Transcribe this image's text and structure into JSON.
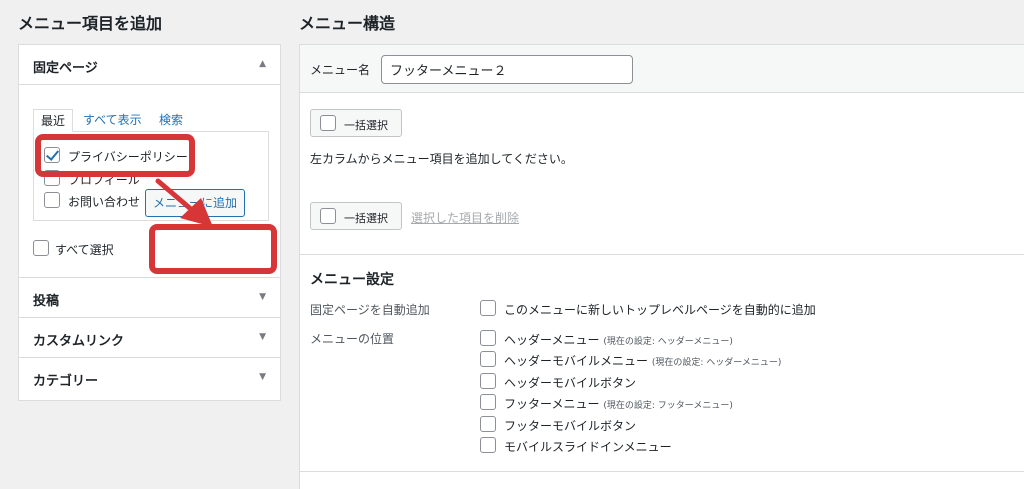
{
  "left": {
    "title": "メニュー項目を追加",
    "section_title": "固定ページ",
    "tabs": [
      "最近",
      "すべて表示",
      "検索"
    ],
    "items": [
      {
        "label": "プライバシーポリシー",
        "checked": true
      },
      {
        "label": "プロフィール",
        "checked": false
      },
      {
        "label": "お問い合わせ",
        "checked": false
      }
    ],
    "select_all_label": "すべて選択",
    "add_button_label": "メニューに追加",
    "collapsed_sections": [
      "投稿",
      "カスタムリンク",
      "カテゴリー"
    ]
  },
  "right": {
    "title": "メニュー構造",
    "menu_name_label": "メニュー名",
    "menu_name_value": "フッターメニュー２",
    "bulk_select_label": "一括選択",
    "hint_text": "左カラムからメニュー項目を追加してください。",
    "delete_selected_label": "選択した項目を削除",
    "settings_title": "メニュー設定",
    "auto_add_label": "固定ページを自動追加",
    "auto_add_option": "このメニューに新しいトップレベルページを自動的に追加",
    "location_label": "メニューの位置",
    "locations": [
      {
        "name": "ヘッダーメニュー",
        "note": "(現在の設定: ヘッダーメニュー)"
      },
      {
        "name": "ヘッダーモバイルメニュー",
        "note": "(現在の設定: ヘッダーメニュー)"
      },
      {
        "name": "ヘッダーモバイルボタン",
        "note": ""
      },
      {
        "name": "フッターメニュー",
        "note": "(現在の設定: フッターメニュー)"
      },
      {
        "name": "フッターモバイルボタン",
        "note": ""
      },
      {
        "name": "モバイルスライドインメニュー",
        "note": ""
      }
    ]
  },
  "colors": {
    "highlight": "#d63638",
    "link": "#2271b1",
    "accent": "#2271b1"
  }
}
